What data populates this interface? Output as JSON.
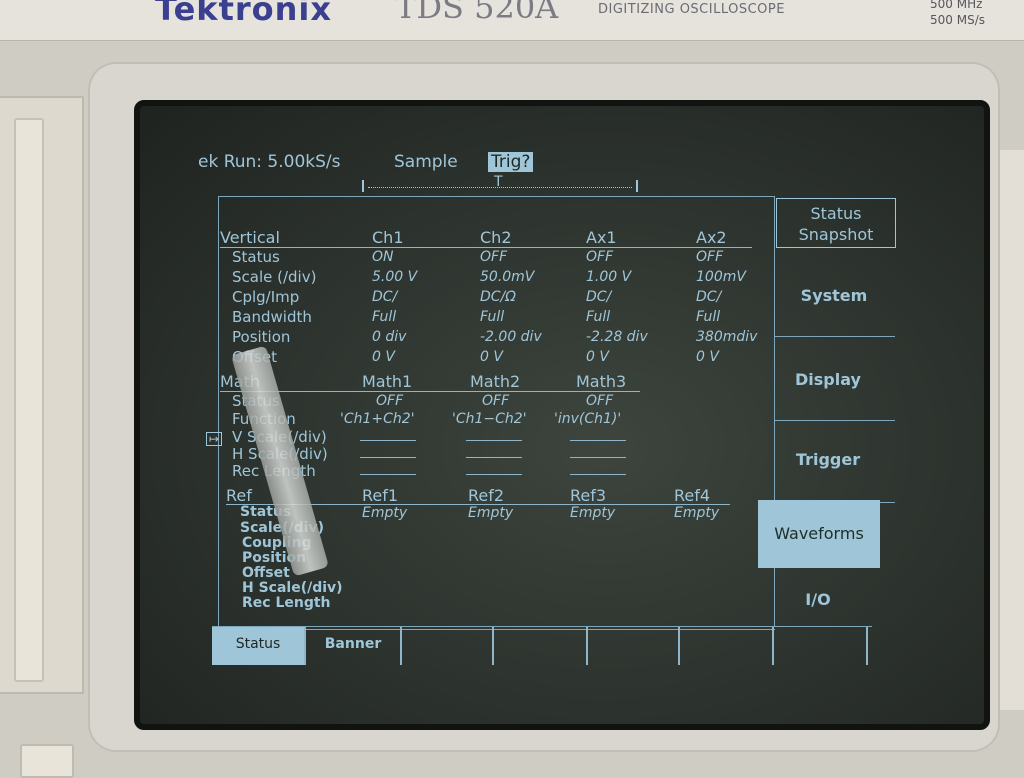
{
  "bezel": {
    "brand": "Tektronix",
    "model": "TDS 520A",
    "model_subtitle": "DIGITIZING OSCILLOSCOPE",
    "spec_bandwidth": "500 MHz",
    "spec_rate": "500 MS/s"
  },
  "status_bar": {
    "run_state": "ek Run: 5.00kS/s",
    "mode": "Sample",
    "trigger": "Trig?"
  },
  "vertical": {
    "title": "Vertical",
    "channels": [
      "Ch1",
      "Ch2",
      "Ax1",
      "Ax2"
    ],
    "rows": [
      {
        "label": "Status",
        "values": [
          "ON",
          "OFF",
          "OFF",
          "OFF"
        ]
      },
      {
        "label": "Scale (/div)",
        "values": [
          "5.00 V",
          "50.0mV",
          "1.00 V",
          "100mV"
        ]
      },
      {
        "label": "Cplg/Imp",
        "values": [
          "DC/",
          "DC/Ω",
          "DC/",
          "DC/"
        ]
      },
      {
        "label": "Bandwidth",
        "values": [
          "Full",
          "Full",
          "Full",
          "Full"
        ]
      },
      {
        "label": "Position",
        "values": [
          "0 div",
          "-2.00 div",
          "-2.28 div",
          "380mdiv"
        ]
      },
      {
        "label": "Offset",
        "values": [
          "0 V",
          "0 V",
          "0 V",
          "0 V"
        ]
      }
    ]
  },
  "math": {
    "title": "Math",
    "channels": [
      "Math1",
      "Math2",
      "Math3"
    ],
    "rows": [
      {
        "label": "Status",
        "values": [
          "OFF",
          "OFF",
          "OFF"
        ]
      },
      {
        "label": "Function",
        "values": [
          "'Ch1+Ch2'",
          "'Ch1−Ch2'",
          "'inv(Ch1)'"
        ]
      },
      {
        "label": "V Scale(/div)"
      },
      {
        "label": "H Scale(/div)"
      },
      {
        "label": "Rec Length"
      }
    ]
  },
  "ref": {
    "title": "Ref",
    "channels": [
      "Ref1",
      "Ref2",
      "Ref3",
      "Ref4"
    ],
    "status_label": "Status",
    "status_values": [
      "Empty",
      "Empty",
      "Empty",
      "Empty"
    ],
    "labels": [
      "Scale(/div)",
      "Coupling",
      "Position",
      "Offset",
      "H Scale(/div)",
      "Rec Length"
    ]
  },
  "side_menu": {
    "snapshot_line1": "Status",
    "snapshot_line2": "Snapshot",
    "items": [
      "System",
      "Display",
      "Trigger",
      "Waveforms",
      "I/O"
    ],
    "selected": "Waveforms"
  },
  "bottom_menu": {
    "items": [
      "Status",
      "Banner",
      "",
      "",
      "",
      "",
      "",
      ""
    ],
    "selected": "Status"
  },
  "colors": {
    "screen_text": "#9fc6d8",
    "screen_bg": "#2c322d",
    "bezel": "#d9d6cf"
  }
}
